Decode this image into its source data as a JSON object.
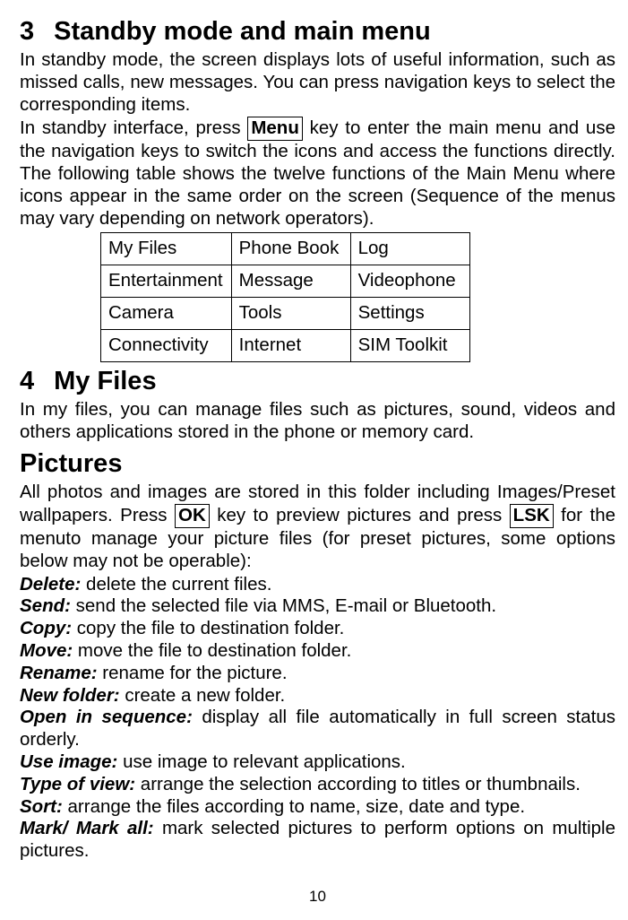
{
  "section3": {
    "num": "3",
    "title": "Standby mode and main menu",
    "para1": "In standby mode, the screen displays lots of useful information, such as missed calls, new messages. You can press navigation keys to select the corresponding items.",
    "para2a": "In standby interface, press ",
    "menu_key": "Menu",
    "para2b": " key to enter the main menu and use the navigation keys to switch the icons and access the functions directly. The following table shows the twelve functions of the Main Menu where icons appear in the same order on the screen (Sequence of the menus may vary depending on network operators).",
    "table": [
      [
        "My Files",
        "Phone Book",
        "Log"
      ],
      [
        "Entertainment",
        "Message",
        "Videophone"
      ],
      [
        " Camera",
        "Tools",
        "Settings"
      ],
      [
        "Connectivity",
        "Internet",
        "SIM Toolkit"
      ]
    ]
  },
  "section4": {
    "num": "4",
    "title": "My Files",
    "para": "In my files, you can manage files such as pictures, sound, videos and others applications stored in the phone or memory card."
  },
  "pictures": {
    "title": "Pictures",
    "para_a": "All photos and images are stored in this folder including Images/Preset wallpapers. Press ",
    "ok_key": "OK",
    "para_b": " key to preview pictures and press ",
    "lsk_key": "LSK",
    "para_c": " for the menuto manage your picture files (for preset pictures, some options below may not be operable):",
    "entries": [
      {
        "label": "Delete:",
        "text": " delete the current files."
      },
      {
        "label": "Send:",
        "text": " send the selected file via MMS, E-mail or Bluetooth."
      },
      {
        "label": "Copy:",
        "text": " copy the file to destination folder."
      },
      {
        "label": "Move:",
        "text": " move the file to destination folder."
      },
      {
        "label": "Rename:",
        "text": " rename for the picture."
      },
      {
        "label": "New folder:",
        "text": " create a new folder."
      },
      {
        "label": "Open in sequence:",
        "text": " display all file automatically in full screen status orderly."
      },
      {
        "label": "Use image:",
        "text": " use image to relevant applications."
      },
      {
        "label": "Type of view:",
        "text": " arrange the selection according to titles or thumbnails."
      },
      {
        "label": "Sort:",
        "text": " arrange the files according to name, size, date and type."
      },
      {
        "label": "Mark/ Mark all:",
        "text": " mark selected pictures to perform options on multiple pictures."
      }
    ]
  },
  "page_number": "10"
}
